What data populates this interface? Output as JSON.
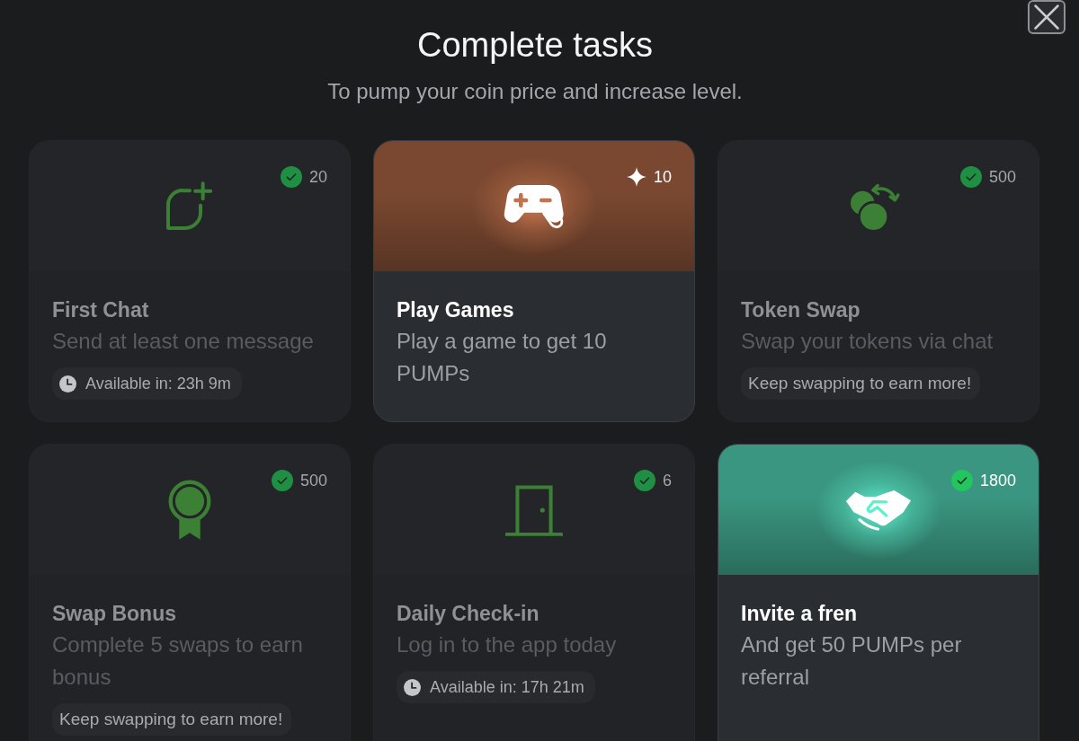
{
  "dialog": {
    "title": "Complete tasks",
    "subtitle": "To pump your coin price and increase level."
  },
  "tasks": [
    {
      "title": "First Chat",
      "description": "Send at least one message",
      "reward": "20",
      "completed": true,
      "active": false,
      "color": "#3b8034",
      "note": {
        "kind": "timer",
        "text": "Available in: 23h 9m"
      }
    },
    {
      "title": "Play Games",
      "description": "Play a game to get 10 PUMPs",
      "reward": "10",
      "completed": false,
      "active": true,
      "color": "#7a4830"
    },
    {
      "title": "Token Swap",
      "description": "Swap your tokens via chat",
      "reward": "500",
      "completed": true,
      "active": false,
      "color": "#3b8034",
      "note": {
        "kind": "text",
        "text": "Keep swapping to earn more!"
      }
    },
    {
      "title": "Swap Bonus",
      "description": "Complete 5 swaps to earn bonus",
      "reward": "500",
      "completed": true,
      "active": false,
      "color": "#3b8034",
      "note": {
        "kind": "text",
        "text": "Keep swapping to earn more!"
      }
    },
    {
      "title": "Daily Check-in",
      "description": "Log in to the app today",
      "reward": "6",
      "completed": true,
      "active": false,
      "color": "#3b8034",
      "note": {
        "kind": "timer",
        "text": "Available in: 17h 21m"
      }
    },
    {
      "title": "Invite a fren",
      "description": "And get 50 PUMPs per referral",
      "reward": "1800",
      "completed": true,
      "active": true,
      "color": "#3a9680"
    }
  ]
}
